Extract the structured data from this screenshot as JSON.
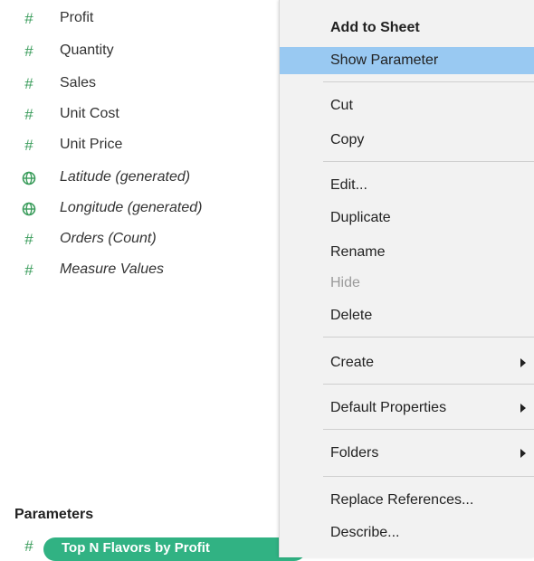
{
  "measures": [
    {
      "label": "Profit",
      "icon": "hash-icon",
      "italic": false
    },
    {
      "label": "Quantity",
      "icon": "hash-icon",
      "italic": false
    },
    {
      "label": "Sales",
      "icon": "hash-icon",
      "italic": false
    },
    {
      "label": "Unit Cost",
      "icon": "hash-icon",
      "italic": false
    },
    {
      "label": "Unit Price",
      "icon": "hash-icon",
      "italic": false
    },
    {
      "label": "Latitude (generated)",
      "icon": "globe-icon",
      "italic": true
    },
    {
      "label": "Longitude (generated)",
      "icon": "globe-icon",
      "italic": true
    },
    {
      "label": "Orders (Count)",
      "icon": "hash-icon",
      "italic": true
    },
    {
      "label": "Measure Values",
      "icon": "hash-icon",
      "italic": true
    }
  ],
  "parameters": {
    "header": "Parameters",
    "items": [
      {
        "label": "Top N Flavors by Profit",
        "icon": "hash-icon"
      }
    ]
  },
  "context_menu": {
    "items": [
      {
        "label": "Add to Sheet",
        "bold": true
      },
      {
        "label": "Show Parameter",
        "highlighted": true
      },
      {
        "label": "Cut"
      },
      {
        "label": "Copy"
      },
      {
        "label": "Edit..."
      },
      {
        "label": "Duplicate"
      },
      {
        "label": "Rename"
      },
      {
        "label": "Hide",
        "disabled": true
      },
      {
        "label": "Delete"
      },
      {
        "label": "Create",
        "submenu": true
      },
      {
        "label": "Default Properties",
        "submenu": true
      },
      {
        "label": "Folders",
        "submenu": true
      },
      {
        "label": "Replace References..."
      },
      {
        "label": "Describe..."
      }
    ]
  },
  "colors": {
    "field_icon": "#3a9c5b",
    "parameter_pill": "#31b283",
    "menu_background": "#f2f2f2",
    "menu_highlight": "#99c9f2",
    "disabled_text": "#9a9a9a"
  }
}
